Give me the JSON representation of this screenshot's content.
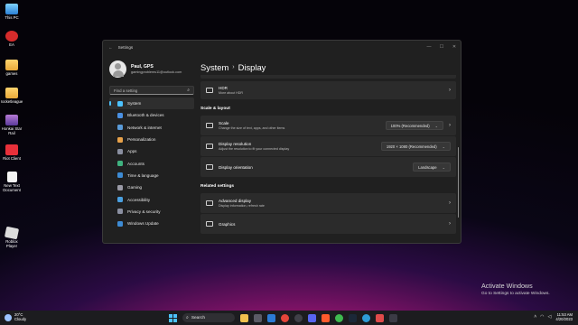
{
  "desktop": {
    "icons": [
      {
        "label": "This PC",
        "glyph": "pc-icon"
      },
      {
        "label": "EA",
        "glyph": "ea-icon"
      },
      {
        "label": "games",
        "glyph": "folder-icon"
      },
      {
        "label": "rocketleague",
        "glyph": "folder-icon"
      },
      {
        "label": "Honkai Star Rail",
        "glyph": "honkai-icon"
      },
      {
        "label": "Riot Client",
        "glyph": "riot-icon"
      },
      {
        "label": "New Text Document",
        "glyph": "text-document-icon"
      },
      {
        "label": "Roblox Player",
        "glyph": "roblox-icon"
      }
    ]
  },
  "window": {
    "title": "Settings",
    "controls": {
      "minimize": "—",
      "maximize": "☐",
      "close": "✕"
    },
    "profile": {
      "name": "Paul, GPS",
      "email": "gamingproblems11@outlook.com"
    },
    "search": {
      "placeholder": "Find a setting"
    },
    "nav": [
      {
        "label": "System",
        "color": "#4cc2ff",
        "active": true
      },
      {
        "label": "Bluetooth & devices",
        "color": "#4a90e2"
      },
      {
        "label": "Network & internet",
        "color": "#5a9bd8"
      },
      {
        "label": "Personalization",
        "color": "#e8a24a"
      },
      {
        "label": "Apps",
        "color": "#8a8fa0"
      },
      {
        "label": "Accounts",
        "color": "#3fb27f"
      },
      {
        "label": "Time & language",
        "color": "#3d8bd4"
      },
      {
        "label": "Gaming",
        "color": "#9a9aa6"
      },
      {
        "label": "Accessibility",
        "color": "#4aa0e0"
      },
      {
        "label": "Privacy & security",
        "color": "#8a8fa0"
      },
      {
        "label": "Windows Update",
        "color": "#3d8bd4"
      }
    ],
    "breadcrumb": {
      "parent": "System",
      "separator": "›",
      "current": "Display"
    },
    "hdr": {
      "title": "HDR",
      "subtitle": "More about HDR"
    },
    "scale_layout": {
      "heading": "Scale & layout",
      "scale": {
        "title": "Scale",
        "subtitle": "Change the size of text, apps, and other items",
        "value": "100% (Recommended)"
      },
      "resolution": {
        "title": "Display resolution",
        "subtitle": "Adjust the resolution to fit your connected display",
        "value": "1920 × 1080 (Recommended)"
      },
      "orientation": {
        "title": "Display orientation",
        "value": "Landscape"
      }
    },
    "related": {
      "heading": "Related settings",
      "advanced": {
        "title": "Advanced display",
        "subtitle": "Display information, refresh rate"
      },
      "graphics": {
        "title": "Graphics"
      }
    }
  },
  "watermark": {
    "line1": "Activate Windows",
    "line2": "Go to Settings to activate Windows."
  },
  "taskbar": {
    "weather": {
      "temp": "20°C",
      "condition": "Cloudy"
    },
    "search_label": "Search",
    "apps": [
      {
        "name": "file-explorer",
        "color": "#f2c14e"
      },
      {
        "name": "game-app",
        "color": "#5b5b66"
      },
      {
        "name": "media-app",
        "color": "#2b7bd6"
      },
      {
        "name": "chrome",
        "color": "#e5453a"
      },
      {
        "name": "obs",
        "color": "#404048"
      },
      {
        "name": "discord",
        "color": "#5865f2"
      },
      {
        "name": "brave",
        "color": "#ff5a2c"
      },
      {
        "name": "chrome-2",
        "color": "#3fb950"
      },
      {
        "name": "steam",
        "color": "#1b2838"
      },
      {
        "name": "edge",
        "color": "#2e9bd6"
      },
      {
        "name": "capture-app",
        "color": "#e14b4b"
      },
      {
        "name": "terminal",
        "color": "#3b3b45"
      }
    ],
    "time": "11:53 AM",
    "date": "4/20/2023"
  }
}
